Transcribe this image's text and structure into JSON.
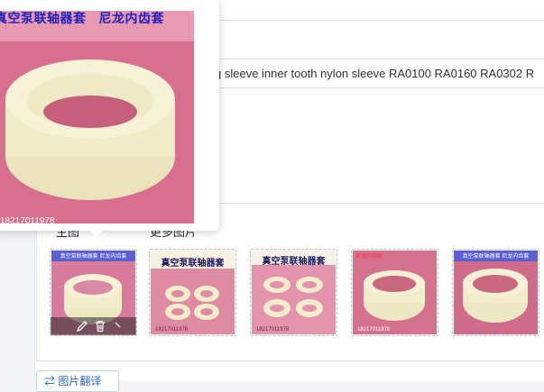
{
  "product": {
    "title_visible": "g sleeve inner tooth nylon sleeve RA0100 RA0160 RA0302 R"
  },
  "images_section": {
    "tab_main": "主图",
    "tab_more": "更多图片",
    "thumbnails": [
      {
        "caption": "真空泵联轴器套  尼龙内齿套",
        "phone": "18217011978"
      },
      {
        "caption": "真空泵联轴器套",
        "phone": "18217011978"
      },
      {
        "caption": "真空泵联轴器套",
        "phone": "18217011978"
      },
      {
        "caption": "尼龙内齿套",
        "phone": "18217011978"
      },
      {
        "caption": "真空泵联轴器套  尼龙内齿套",
        "phone": ""
      }
    ]
  },
  "popup": {
    "caption_left": "真空泵联轴器套",
    "caption_right": "尼龙内齿套",
    "phone": "18217011978"
  },
  "translate_button": {
    "label": "图片翻译"
  },
  "colors": {
    "pink_background": "#d86f8f",
    "nylon": "#f1ecc8",
    "accent_blue": "#2d6bd3"
  }
}
